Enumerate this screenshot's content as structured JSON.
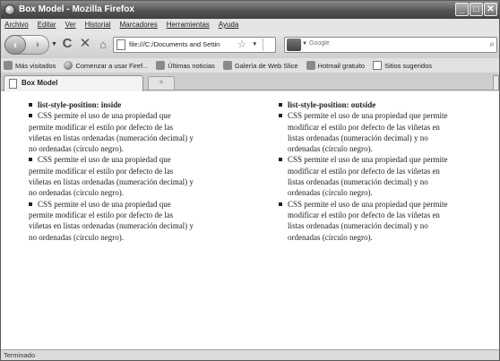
{
  "window": {
    "title": "Box Model - Mozilla Firefox",
    "controls": {
      "minimize": "_",
      "maximize": "□",
      "close": "✕"
    }
  },
  "menu": [
    "Archivo",
    "Editar",
    "Ver",
    "Historial",
    "Marcadores",
    "Herramientas",
    "Ayuda"
  ],
  "nav": {
    "back": "‹",
    "forward": "›",
    "reload": "C",
    "stop": "✕",
    "home": "⌂",
    "url": "file:///C:/Documents and Settin",
    "search_placeholder": "Google",
    "magnifier": "⌕"
  },
  "bookmarks": [
    "Más visitados",
    "Comenzar a usar Firef...",
    "Últimas noticias",
    "Galería de Web Slice",
    "Hotmail gratuito",
    "Sitios sugeridos"
  ],
  "tabs": [
    {
      "label": "Box Model"
    }
  ],
  "new_tab": "+",
  "page": {
    "inside": {
      "heading": "list-style-position: inside",
      "lines": [
        "CSS permite el uso de una propiedad que",
        "permite modificar el estilo por defecto de las",
        "viñetas en listas ordenadas (numeración decimal) y",
        "no ordenadas (círculo negro).",
        "CSS permite el uso de una propiedad que",
        "permite modificar el estilo por defecto de las",
        "viñetas en listas ordenadas (numeración decimal) y",
        "no ordenadas (círculo negro).",
        "CSS permite el uso de una propiedad que",
        "permite modificar el estilo por defecto de las",
        "viñetas en listas ordenadas (numeración decimal) y",
        "no ordenadas (círculo negro)."
      ]
    },
    "outside": {
      "heading": "list-style-position: outside",
      "items": [
        [
          "CSS permite el uso de una propiedad que permite",
          "modificar el estilo por defecto de las viñetas en",
          "listas ordenadas (numeración decimal) y no",
          "ordenadas (círculo negro)."
        ],
        [
          "CSS permite el uso de una propiedad que permite",
          "modificar el estilo por defecto de las viñetas en",
          "listas ordenadas (numeración decimal) y no",
          "ordenadas (círculo negro)."
        ],
        [
          "CSS permite el uso de una propiedad que permite",
          "modificar el estilo por defecto de las viñetas en",
          "listas ordenadas (numeración decimal) y no",
          "ordenadas (círculo negro)."
        ]
      ]
    }
  },
  "status": "Terminado"
}
